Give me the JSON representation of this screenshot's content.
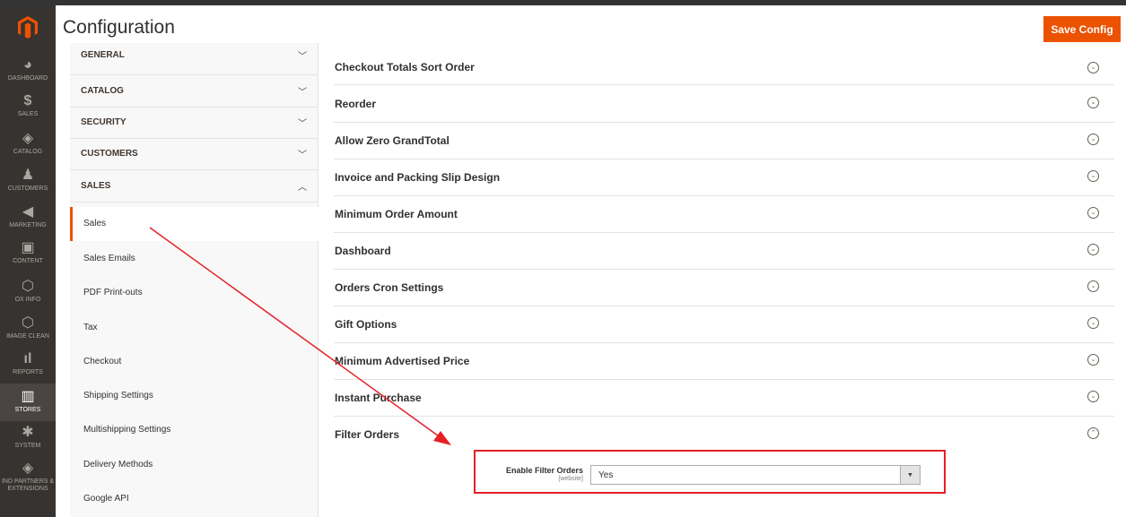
{
  "header": {
    "title": "Configuration",
    "save_label": "Save Config"
  },
  "admin_nav": [
    {
      "label": "DASHBOARD",
      "icon": "dashboard-icon"
    },
    {
      "label": "SALES",
      "icon": "dollar-icon"
    },
    {
      "label": "CATALOG",
      "icon": "cube-icon"
    },
    {
      "label": "CUSTOMERS",
      "icon": "person-icon"
    },
    {
      "label": "MARKETING",
      "icon": "megaphone-icon"
    },
    {
      "label": "CONTENT",
      "icon": "layout-icon"
    },
    {
      "label": "OX INFO",
      "icon": "hexagon-icon"
    },
    {
      "label": "IMAGE CLEAN",
      "icon": "hexagon-icon"
    },
    {
      "label": "REPORTS",
      "icon": "bar-chart-icon"
    },
    {
      "label": "STORES",
      "icon": "store-icon"
    },
    {
      "label": "SYSTEM",
      "icon": "gear-icon"
    },
    {
      "label": "IND PARTNERS & EXTENSIONS",
      "icon": "cube-icon"
    }
  ],
  "config_tabs": [
    {
      "label": "GENERAL",
      "expanded": false
    },
    {
      "label": "CATALOG",
      "expanded": false
    },
    {
      "label": "SECURITY",
      "expanded": false
    },
    {
      "label": "CUSTOMERS",
      "expanded": false
    },
    {
      "label": "SALES",
      "expanded": true
    }
  ],
  "sales_items": [
    {
      "label": "Sales",
      "active": true
    },
    {
      "label": "Sales Emails"
    },
    {
      "label": "PDF Print-outs"
    },
    {
      "label": "Tax"
    },
    {
      "label": "Checkout"
    },
    {
      "label": "Shipping Settings"
    },
    {
      "label": "Multishipping Settings"
    },
    {
      "label": "Delivery Methods"
    },
    {
      "label": "Google API"
    }
  ],
  "sections": [
    {
      "label": "Checkout Totals Sort Order",
      "expanded": false
    },
    {
      "label": "Reorder",
      "expanded": false
    },
    {
      "label": "Allow Zero GrandTotal",
      "expanded": false
    },
    {
      "label": "Invoice and Packing Slip Design",
      "expanded": false
    },
    {
      "label": "Minimum Order Amount",
      "expanded": false
    },
    {
      "label": "Dashboard",
      "expanded": false
    },
    {
      "label": "Orders Cron Settings",
      "expanded": false
    },
    {
      "label": "Gift Options",
      "expanded": false
    },
    {
      "label": "Minimum Advertised Price",
      "expanded": false
    },
    {
      "label": "Instant Purchase",
      "expanded": false
    },
    {
      "label": "Filter Orders",
      "expanded": true
    }
  ],
  "filter_orders": {
    "field_label": "Enable Filter Orders",
    "scope": "[website]",
    "value": "Yes"
  },
  "colors": {
    "accent": "#eb5202",
    "annotation": "#e41f26",
    "nav_bg": "#373330"
  }
}
